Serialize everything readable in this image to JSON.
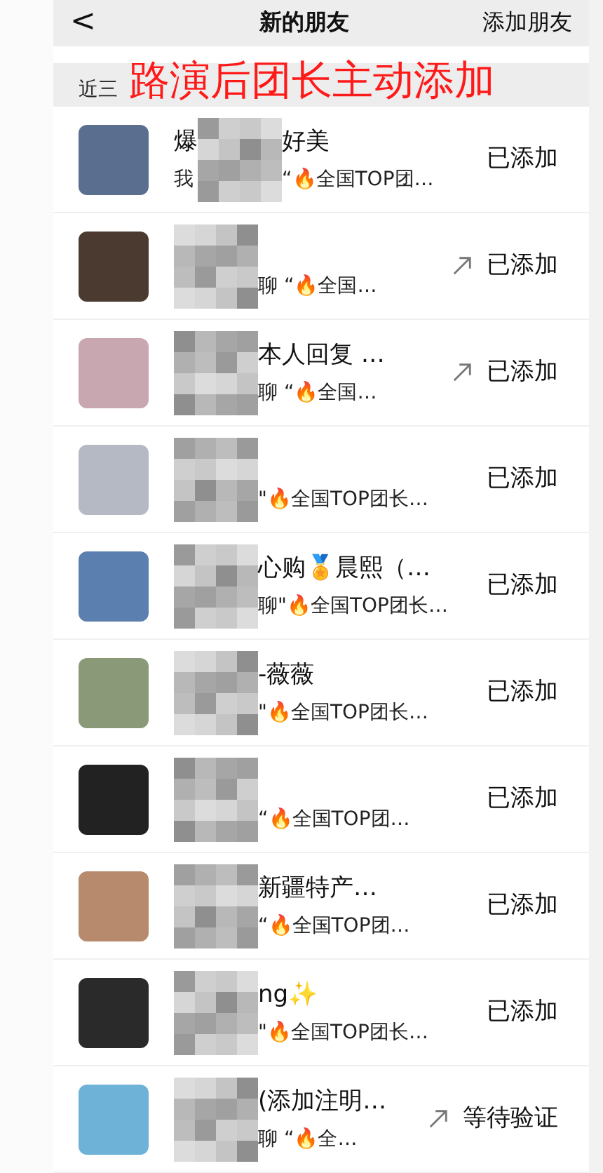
{
  "nav": {
    "back": "<",
    "title": "新的朋友",
    "action": "添加朋友"
  },
  "annotation": "路演后团长主动添加",
  "section": "近三",
  "rows": [
    {
      "name_before": "爆",
      "name_after": "好美",
      "message_before": "我",
      "message_after": "“🔥全国TOP团…",
      "status": "已添加",
      "arrow": false
    },
    {
      "name_before": "",
      "name_after": "",
      "message_before": "",
      "message_after": "聊 “🔥全国…",
      "status": "已添加",
      "arrow": true
    },
    {
      "name_before": "",
      "name_after": "本人回复 …",
      "message_before": "",
      "message_after": "聊 “🔥全国…",
      "status": "已添加",
      "arrow": true
    },
    {
      "name_before": "",
      "name_after": "",
      "message_before": "",
      "message_after": "\"🔥全国TOP团长…",
      "status": "已添加",
      "arrow": false
    },
    {
      "name_before": "",
      "name_after": "心购🏅晨熙（…",
      "message_before": "",
      "message_after": "聊\"🔥全国TOP团长…",
      "status": "已添加",
      "arrow": false
    },
    {
      "name_before": "",
      "name_after": "-薇薇",
      "message_before": "",
      "message_after": "\"🔥全国TOP团长…",
      "status": "已添加",
      "arrow": false
    },
    {
      "name_before": "",
      "name_after": "",
      "message_before": "",
      "message_after": "“🔥全国TOP团…",
      "status": "已添加",
      "arrow": false
    },
    {
      "name_before": "",
      "name_after": "新疆特产…",
      "message_before": "",
      "message_after": "“🔥全国TOP团…",
      "status": "已添加",
      "arrow": false
    },
    {
      "name_before": "",
      "name_after": "ng✨",
      "message_before": "",
      "message_after": "\"🔥全国TOP团长…",
      "status": "已添加",
      "arrow": false
    },
    {
      "name_before": "",
      "name_after": "(添加注明…",
      "message_before": "",
      "message_after": "聊 “🔥全…",
      "status": "等待验证",
      "arrow": true
    }
  ]
}
